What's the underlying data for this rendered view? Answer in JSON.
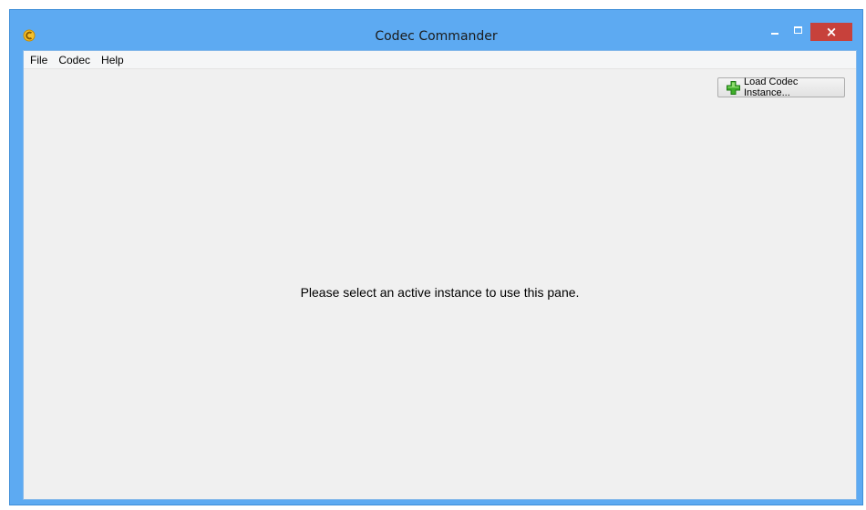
{
  "window": {
    "title": "Codec Commander",
    "app_icon": "codec-commander-icon",
    "controls": {
      "minimize_icon": "minimize-icon",
      "maximize_icon": "maximize-icon",
      "close_icon": "close-icon",
      "close_glyph": "×"
    },
    "accent_color": "#5daaf2",
    "close_color": "#c7413b"
  },
  "menubar": {
    "items": [
      {
        "label": "File"
      },
      {
        "label": "Codec"
      },
      {
        "label": "Help"
      }
    ]
  },
  "toolbar": {
    "load_button": {
      "label": "Load Codec Instance...",
      "icon": "green-plus-icon"
    }
  },
  "main": {
    "message": "Please select an active instance to use this pane."
  }
}
